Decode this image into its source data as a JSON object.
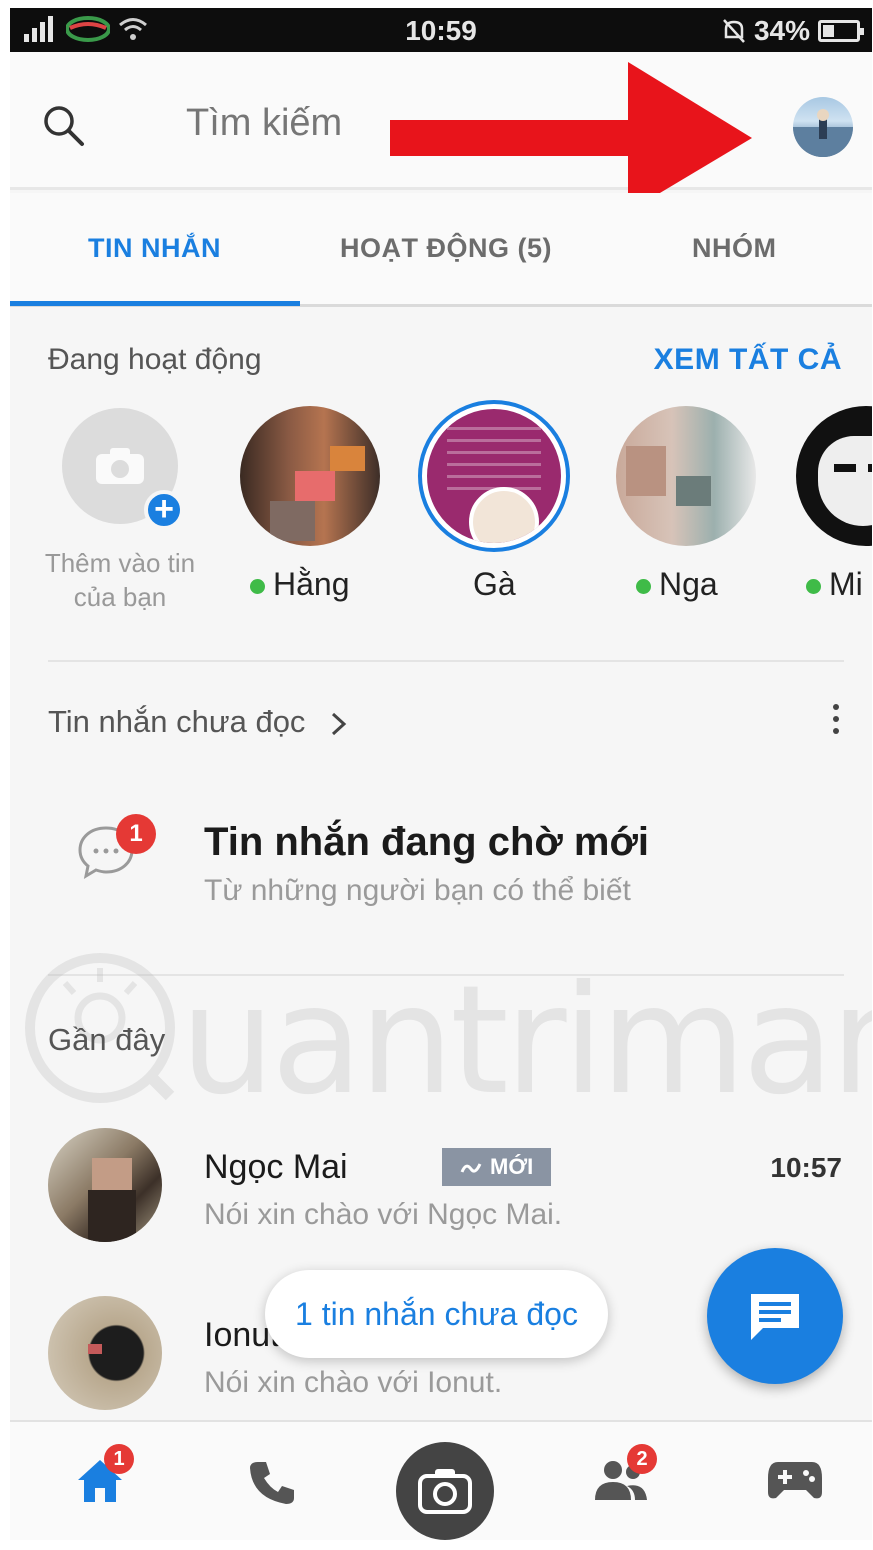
{
  "status_bar": {
    "time": "10:59",
    "battery": "34%",
    "battery_level": 0.34
  },
  "search": {
    "placeholder": "Tìm kiếm"
  },
  "tabs": [
    {
      "label": "TIN NHẮN",
      "active": true
    },
    {
      "label": "HOẠT ĐỘNG (5)",
      "active": false
    },
    {
      "label": "NHÓM",
      "active": false
    }
  ],
  "active_section": {
    "title": "Đang hoạt động",
    "see_all": "XEM TẤT CẢ",
    "add_story_label": "Thêm vào tin của bạn",
    "contacts": [
      {
        "name": "Hằng",
        "online": true
      },
      {
        "name": "Gà",
        "online": false
      },
      {
        "name": "Nga",
        "online": true
      },
      {
        "name": "Mi",
        "online": true
      }
    ]
  },
  "unread_section": {
    "title": "Tin nhắn chưa đọc"
  },
  "pending": {
    "badge": "1",
    "title": "Tin nhắn đang chờ mới",
    "subtitle": "Từ những người bạn có thể biết"
  },
  "recent_section": {
    "title": "Gần đây"
  },
  "watermark": "uantrimang",
  "conversations": [
    {
      "name": "Ngọc Mai",
      "badge": "MỚI",
      "time": "10:57",
      "preview": "Nói xin chào với Ngọc Mai."
    },
    {
      "name": "Ionut",
      "preview": "Nói xin chào với Ionut."
    }
  ],
  "unread_pill": "1 tin nhắn chưa đọc",
  "bottom_nav": {
    "home_badge": "1",
    "people_badge": "2"
  },
  "colors": {
    "accent": "#1a7fe0",
    "badge": "#e53935",
    "online": "#3fbb48",
    "arrow": "#e8141b"
  }
}
